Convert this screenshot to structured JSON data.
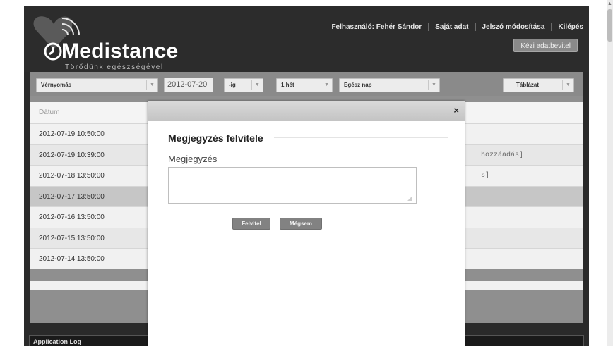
{
  "brand": {
    "name": "Medistance",
    "tagline": "Törődünk egészségével"
  },
  "topnav": {
    "user_label": "Felhasználó: Fehér Sándor",
    "own_data": "Saját adat",
    "password_change": "Jelszó módosítása",
    "logout": "Kilépés",
    "manual_entry": "Kézi adatbevitel"
  },
  "filters": {
    "measurement": "Vérnyomás",
    "date": "2012-07-20",
    "until": "-ig",
    "period": "1 hét",
    "daypart": "Egész nap",
    "view": "Táblázat"
  },
  "table": {
    "header": "Dátum",
    "rows": [
      {
        "date": "2012-07-19 10:50:00",
        "note": ""
      },
      {
        "date": "2012-07-19 10:39:00",
        "note": "hozzáadás]"
      },
      {
        "date": "2012-07-18 13:50:00",
        "note": "s]"
      },
      {
        "date": "2012-07-17 13:50:00",
        "note": ""
      },
      {
        "date": "2012-07-16 13:50:00",
        "note": ""
      },
      {
        "date": "2012-07-15 13:50:00",
        "note": ""
      },
      {
        "date": "2012-07-14 13:50:00",
        "note": ""
      }
    ]
  },
  "log": {
    "title": "Application Log"
  },
  "modal": {
    "close": "×",
    "title": "Megjegyzés felvitele",
    "field_label": "Megjegyzés",
    "field_value": "",
    "submit": "Felvitel",
    "cancel": "Mégsem"
  },
  "colors": {
    "frame": "#2a2a2a",
    "panel": "#8f8f8f",
    "button": "#828282"
  }
}
